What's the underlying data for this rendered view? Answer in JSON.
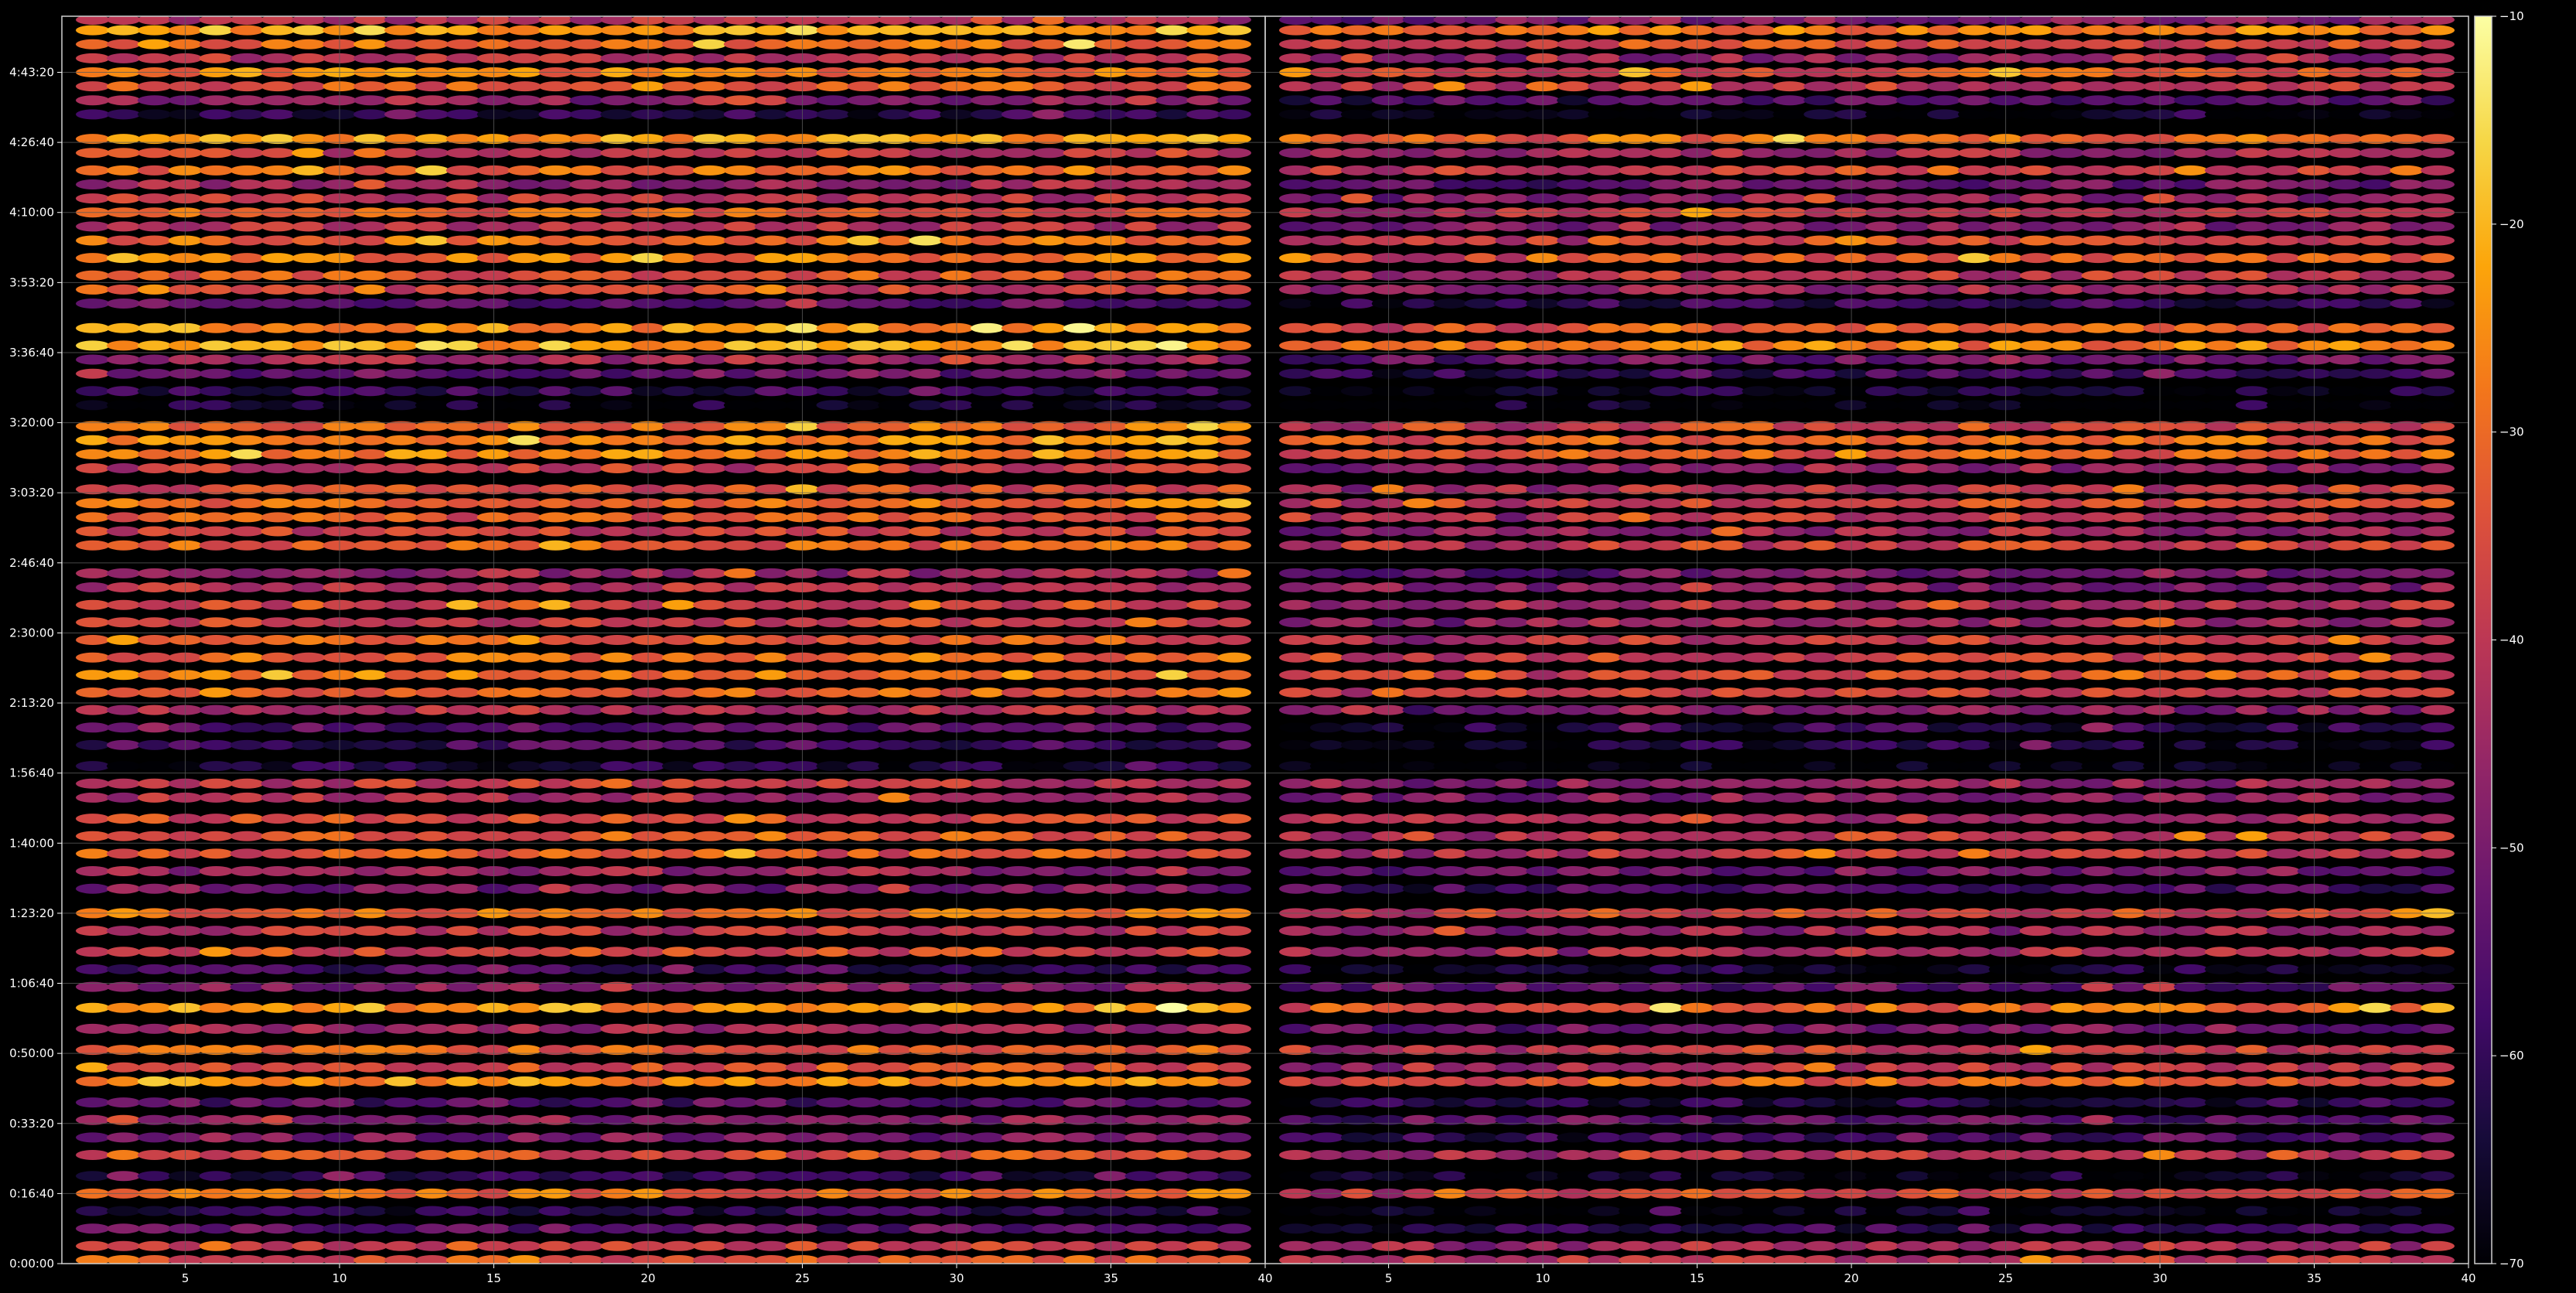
{
  "chart_data": {
    "type": "heatmap",
    "title": "",
    "xlabel": "",
    "ylabel": "",
    "grid": true,
    "colormap": "inferno",
    "background_color": "#000000",
    "grid_color": "#5a5a5a",
    "x_panels": [
      {
        "xlim": [
          1,
          40
        ],
        "ticks": [
          5,
          10,
          15,
          20,
          25,
          30,
          35,
          40
        ]
      },
      {
        "xlim": [
          1,
          40
        ],
        "ticks": [
          5,
          10,
          15,
          20,
          25,
          30,
          35,
          40
        ]
      }
    ],
    "ylim_seconds": [
      0,
      17800
    ],
    "y_ticks": [
      {
        "label": "0:00:00",
        "value": 0
      },
      {
        "label": "0:16:40",
        "value": 1000
      },
      {
        "label": "0:33:20",
        "value": 2000
      },
      {
        "label": "0:50:00",
        "value": 3000
      },
      {
        "label": "1:06:40",
        "value": 4000
      },
      {
        "label": "1:23:20",
        "value": 5000
      },
      {
        "label": "1:40:00",
        "value": 6000
      },
      {
        "label": "1:56:40",
        "value": 7000
      },
      {
        "label": "2:13:20",
        "value": 8000
      },
      {
        "label": "2:30:00",
        "value": 9000
      },
      {
        "label": "2:46:40",
        "value": 10000
      },
      {
        "label": "3:03:20",
        "value": 11000
      },
      {
        "label": "3:20:00",
        "value": 12000
      },
      {
        "label": "3:36:40",
        "value": 13000
      },
      {
        "label": "3:53:20",
        "value": 14000
      },
      {
        "label": "4:10:00",
        "value": 15000
      },
      {
        "label": "4:26:40",
        "value": 16000
      },
      {
        "label": "4:43:20",
        "value": 17000
      }
    ],
    "colorbar": {
      "min": -70,
      "max": -10,
      "ticks": [
        {
          "label": "−10",
          "value": -10
        },
        {
          "label": "−20",
          "value": -20
        },
        {
          "label": "−30",
          "value": -30
        },
        {
          "label": "−40",
          "value": -40
        },
        {
          "label": "−50",
          "value": -50
        },
        {
          "label": "−60",
          "value": -60
        },
        {
          "label": "−70",
          "value": -70
        }
      ]
    },
    "row_spacing_seconds": 130,
    "rows_approx": [
      {
        "y": 17750,
        "level": -42
      },
      {
        "y": 17600,
        "level": -22
      },
      {
        "y": 17400,
        "level": -30
      },
      {
        "y": 17200,
        "level": -40
      },
      {
        "y": 17000,
        "level": -28
      },
      {
        "y": 16800,
        "level": -33
      },
      {
        "y": 16600,
        "level": -48
      },
      {
        "y": 16400,
        "level": -62
      },
      {
        "y": 16050,
        "level": -24
      },
      {
        "y": 15850,
        "level": -38
      },
      {
        "y": 15600,
        "level": -30
      },
      {
        "y": 15400,
        "level": -45
      },
      {
        "y": 15200,
        "level": -40
      },
      {
        "y": 15000,
        "level": -32
      },
      {
        "y": 14800,
        "level": -42
      },
      {
        "y": 14600,
        "level": -30
      },
      {
        "y": 14350,
        "level": -28
      },
      {
        "y": 14100,
        "level": -34
      },
      {
        "y": 13900,
        "level": -38
      },
      {
        "y": 13700,
        "level": -55
      },
      {
        "y": 13350,
        "level": -25
      },
      {
        "y": 13100,
        "level": -22
      },
      {
        "y": 12900,
        "level": -45
      },
      {
        "y": 12700,
        "level": -52
      },
      {
        "y": 12450,
        "level": -60
      },
      {
        "y": 12250,
        "level": -66
      },
      {
        "y": 11950,
        "level": -30
      },
      {
        "y": 11750,
        "level": -25
      },
      {
        "y": 11550,
        "level": -26
      },
      {
        "y": 11350,
        "level": -40
      },
      {
        "y": 11050,
        "level": -36
      },
      {
        "y": 10850,
        "level": -30
      },
      {
        "y": 10650,
        "level": -34
      },
      {
        "y": 10450,
        "level": -38
      },
      {
        "y": 10250,
        "level": -32
      },
      {
        "y": 9850,
        "level": -45
      },
      {
        "y": 9650,
        "level": -42
      },
      {
        "y": 9400,
        "level": -36
      },
      {
        "y": 9150,
        "level": -38
      },
      {
        "y": 8900,
        "level": -33
      },
      {
        "y": 8650,
        "level": -30
      },
      {
        "y": 8400,
        "level": -28
      },
      {
        "y": 8150,
        "level": -32
      },
      {
        "y": 7900,
        "level": -42
      },
      {
        "y": 7650,
        "level": -55
      },
      {
        "y": 7400,
        "level": -58
      },
      {
        "y": 7100,
        "level": -64
      },
      {
        "y": 6850,
        "level": -40
      },
      {
        "y": 6650,
        "level": -42
      },
      {
        "y": 6350,
        "level": -36
      },
      {
        "y": 6100,
        "level": -32
      },
      {
        "y": 5850,
        "level": -34
      },
      {
        "y": 5600,
        "level": -45
      },
      {
        "y": 5350,
        "level": -50
      },
      {
        "y": 5000,
        "level": -30
      },
      {
        "y": 4750,
        "level": -40
      },
      {
        "y": 4450,
        "level": -36
      },
      {
        "y": 4200,
        "level": -58
      },
      {
        "y": 3950,
        "level": -48
      },
      {
        "y": 3650,
        "level": -24
      },
      {
        "y": 3350,
        "level": -45
      },
      {
        "y": 3050,
        "level": -32
      },
      {
        "y": 2800,
        "level": -35
      },
      {
        "y": 2600,
        "level": -26
      },
      {
        "y": 2300,
        "level": -55
      },
      {
        "y": 2050,
        "level": -48
      },
      {
        "y": 1800,
        "level": -50
      },
      {
        "y": 1550,
        "level": -34
      },
      {
        "y": 1250,
        "level": -60
      },
      {
        "y": 1000,
        "level": -30
      },
      {
        "y": 750,
        "level": -62
      },
      {
        "y": 500,
        "level": -54
      },
      {
        "y": 250,
        "level": -36
      },
      {
        "y": 50,
        "level": -34
      }
    ],
    "right_panel_level_offset": -6
  }
}
